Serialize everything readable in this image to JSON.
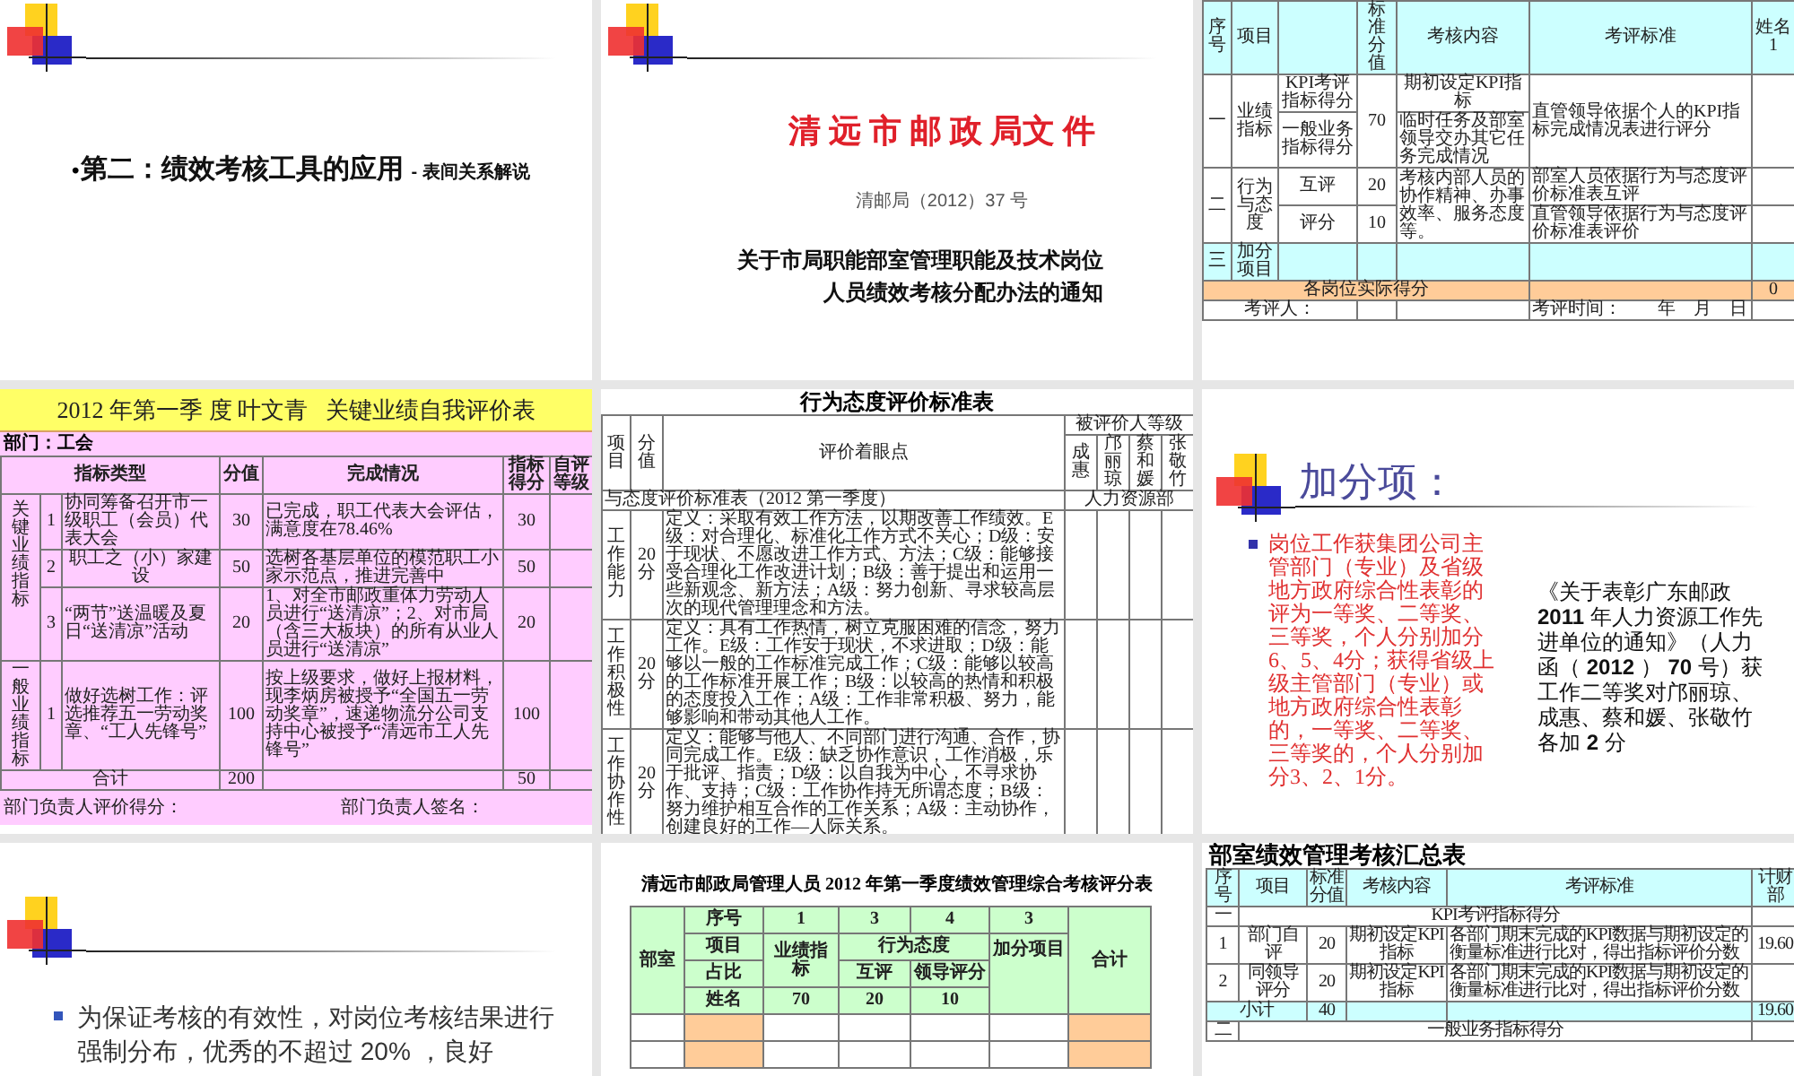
{
  "slides": [
    {
      "kind": "section_title",
      "bullet": "•",
      "title": "第二：绩效考核工具的应用",
      "subtitle": "- 表间关系解说"
    },
    {
      "kind": "document",
      "heading": "清 远 市 邮 政 局文 件",
      "doc_number": "清邮局（2012）37 号",
      "title_lines": [
        "关于市局职能部室管理职能及技术岗位",
        "人员绩效考核分配办法的通知"
      ]
    },
    {
      "kind": "kpi_table",
      "table": {
        "rows": [
          {
            "color": "#ccffff",
            "cells": [
              {
                "text": "序号"
              },
              {
                "text": "项目"
              },
              {},
              {
                "text": "标准分值"
              },
              {
                "text": "考核内容"
              },
              {
                "text": "考评标准"
              },
              {
                "text": "姓名1"
              }
            ]
          },
          {
            "color": "#ffffff",
            "cells": [
              {
                "text": "一",
                "rowspan": 2
              },
              {
                "text": "业绩指标",
                "rowspan": 2
              },
              {
                "text": "KPI考评指标得分"
              },
              {
                "text": "70",
                "rowspan": 2
              },
              {
                "text": "期初设定KPI指标"
              },
              {
                "text": "直管领导依据个人的KPI指标完成情况表进行评分",
                "rowspan": 2
              },
              {
                "rowspan": 2
              }
            ]
          },
          {
            "color": "#ffffff",
            "cells": [
              {
                "text": "一般业务指标得分"
              },
              {
                "text": "临时任务及部室领导交办其它任务完成情况"
              }
            ]
          },
          {
            "color": "#ffffff",
            "cells": [
              {
                "text": "二",
                "rowspan": 2
              },
              {
                "text": "行为与态度",
                "rowspan": 2
              },
              {
                "text": "互评"
              },
              {
                "text": "20"
              },
              {
                "text": "考核内部人员的协作精神、办事效率、服务态度等。",
                "rowspan": 2
              },
              {
                "text": "部室人员依据行为与态度评价标准表互评"
              },
              {}
            ]
          },
          {
            "color": "#ffffff",
            "cells": [
              {
                "text": "评分"
              },
              {
                "text": "10"
              },
              {
                "text": "直管领导依据行为与态度评价标准表评价"
              },
              {}
            ]
          },
          {
            "color": "#ccffff",
            "cells": [
              {
                "text": "三"
              },
              {
                "text": "加分项目"
              },
              {},
              {},
              {},
              {},
              {}
            ]
          },
          {
            "color": "#ffcc99",
            "cells": [
              {
                "text": "各岗位实际得分",
                "colspan": 5
              },
              {},
              {
                "text": "0"
              }
            ]
          },
          {
            "color": "#ffffff",
            "cells": [
              {
                "text": "考评人：",
                "colspan": 3
              },
              {},
              {},
              {
                "text": "考评时间：　　年　月　日"
              },
              {}
            ]
          }
        ]
      }
    },
    {
      "kind": "self_review",
      "title": "2012 年第一季 度 叶文青   关键业绩自我评价表",
      "department": "部门：工会",
      "table": {
        "rows": [
          {
            "kind": "header",
            "cells": [
              {
                "text": "指标类型",
                "colspan": 3
              },
              {
                "text": "分值"
              },
              {
                "text": "完成情况"
              },
              {
                "text": "指标得分"
              },
              {
                "text": "自评等级"
              }
            ]
          },
          {
            "kind": "body",
            "cells": [
              {
                "text": "关键业绩指标",
                "rowspan": 3
              },
              {
                "text": "1"
              },
              {
                "text": "协同筹备召开市一级职工（会员）代表大会"
              },
              {
                "text": "30"
              },
              {
                "text": "已完成，职工代表大会评估，满意度在78.46%"
              },
              {
                "text": "30"
              },
              {}
            ]
          },
          {
            "kind": "body",
            "cells": [
              {
                "text": "2"
              },
              {
                "text": "职工之（小）家建设"
              },
              {
                "text": "50"
              },
              {
                "text": "选树各基层单位的模范职工小家示范点，推进完善中"
              },
              {
                "text": "50"
              },
              {}
            ]
          },
          {
            "kind": "body",
            "cells": [
              {
                "text": "3"
              },
              {
                "text": "“两节”送温暖及夏日“送清凉”活动"
              },
              {
                "text": "20"
              },
              {
                "text": "1、对全市邮政重体力劳动人员进行“送清凉”；2、对市局（含三大板块）的所有从业人员进行“送清凉”"
              },
              {
                "text": "20"
              },
              {}
            ]
          },
          {
            "kind": "body",
            "cells": [
              {
                "text": "一般业绩指标"
              },
              {
                "text": "1"
              },
              {
                "text": "做好选树工作：评选推荐五一劳动奖章、“工人先锋号”"
              },
              {
                "text": "100"
              },
              {
                "text": "按上级要求，做好上报材料，现李炳房被授予“全国五一劳动奖章”，速递物流分公司支持中心被授予“清远市工人先锋号”"
              },
              {
                "text": "100"
              },
              {}
            ]
          },
          {
            "kind": "body",
            "cells": [
              {
                "text": "合计",
                "colspan": 3
              },
              {
                "text": "200"
              },
              {},
              {
                "text": "50"
              },
              {}
            ]
          }
        ]
      },
      "footer": [
        "部门负责人评价得分：",
        "部门负责人签名："
      ]
    },
    {
      "kind": "behavior_standard",
      "title": "行为态度评价标准表",
      "table": {
        "rows": [
          {
            "cells": [
              {
                "text": "项目",
                "rowspan": 2
              },
              {
                "text": "分值",
                "rowspan": 2
              },
              {
                "text": "评价着眼点",
                "rowspan": 2
              },
              {
                "text": "被评价人等级",
                "colspan": 4
              }
            ]
          },
          {
            "cells": [
              {
                "text": "成惠"
              },
              {
                "text": "邝丽琼"
              },
              {
                "text": "蔡和媛"
              },
              {
                "text": "张敬竹"
              }
            ]
          },
          {
            "cells": [
              {
                "text": "与态度评价标准表（2012 第一季度）",
                "colspan": 3
              },
              {
                "text": "人力资源部",
                "colspan": 4
              }
            ]
          },
          {
            "cells": [
              {
                "text": "工作能力"
              },
              {
                "text": "20分"
              },
              {
                "text": "定义：采取有效工作方法，以期改善工作绩效。E级：对合理化、标准化工作方式不关心；D级：安于现状、不愿改进工作方式、方法；C级：能够接受合理化工作改进计划；B级：善于提出和运用一些新观念、新方法；A级：努力创新、寻求较高层次的现代管理理念和方法。"
              },
              {},
              {},
              {},
              {}
            ]
          },
          {
            "cells": [
              {
                "text": "工作积极性"
              },
              {
                "text": "20分"
              },
              {
                "text": "定义：具有工作热情，树立克服困难的信念，努力工作。E级：工作安于现状，不求进取；D级：能够以一般的工作标准完成工作；C级：能够以较高的工作标准开展工作；B级：以较高的热情和积极的态度投入工作；A级：工作非常积极、努力，能够影响和带动其他人工作。"
              },
              {},
              {},
              {},
              {}
            ]
          },
          {
            "cells": [
              {
                "text": "工作协作性"
              },
              {
                "text": "20分"
              },
              {
                "text": "定义：能够与他人、不同部门进行沟通、合作，协同完成工作。E级：缺乏协作意识，工作消极，乐于批评、指责；D级：以自我为中心，不寻求协作、支持；C级：工作协作持无所谓态度；B级：努力维护相互合作的工作关系；A级：主动协作，创建良好的工作—人际关系。"
              },
              {},
              {},
              {},
              {}
            ]
          }
        ]
      }
    },
    {
      "kind": "bonus",
      "title": "加分项：",
      "bullet_text": "岗位工作获集团公司主管部门（专业）及省级地方政府综合性表彰的评为一等奖、二等奖、三等奖，个人分别加分6、5、4分；获得省级上级主管部门（专业）或地方政府综合性表彰的，一等奖、二等奖、三等奖的，个人分别加分3、2、1分。",
      "note": "《关于表彰广东邮政 **2011** 年人力资源工作先进单位的通知》（人力函（ **2012** ） **70** 号）获工作二等奖对邝丽琼、成惠、蔡和媛、张敬竹各加 **2** 分"
    },
    {
      "kind": "bullet",
      "text": "为保证考核的有效性，对岗位考核结果进行强制分布，优秀的不超过 20% ，良好"
    },
    {
      "kind": "score_sheet",
      "title": "清远市邮政局管理人员 2012 年第一季度绩效管理综合考核评分表",
      "table": {
        "rows": [
          {
            "kind": "header",
            "cells": [
              {
                "text": "部室",
                "rowspan": 4
              },
              {
                "text": "序号"
              },
              {
                "text": "1"
              },
              {
                "text": "3"
              },
              {
                "text": "4"
              },
              {
                "text": "3"
              },
              {
                "text": "合计",
                "rowspan": 4
              }
            ]
          },
          {
            "kind": "header",
            "cells": [
              {
                "text": "项目"
              },
              {
                "text": "业绩指标",
                "rowspan": 2
              },
              {
                "text": "行为态度",
                "colspan": 2
              },
              {
                "text": "加分项目",
                "rowspan": 3
              }
            ]
          },
          {
            "kind": "header",
            "cells": [
              {
                "text": "占比"
              },
              {
                "text": "互评"
              },
              {
                "text": "领导评分"
              }
            ]
          },
          {
            "kind": "header",
            "cells": [
              {
                "text": "姓名"
              },
              {
                "text": "70"
              },
              {
                "text": "20"
              },
              {
                "text": "10"
              }
            ]
          },
          {
            "kind": "body",
            "cells": [
              {},
              {
                "color": "#ffcc99"
              },
              {},
              {},
              {},
              {},
              {
                "color": "#ffcc99"
              }
            ]
          },
          {
            "kind": "body",
            "cells": [
              {},
              {
                "color": "#ffcc99"
              },
              {},
              {},
              {},
              {},
              {
                "color": "#ffcc99"
              }
            ]
          }
        ]
      }
    },
    {
      "kind": "summary_table",
      "title": "部室绩效管理考核汇总表",
      "table": {
        "rows": [
          {
            "color": "#ccffff",
            "cells": [
              {
                "text": "序号"
              },
              {
                "text": "项目"
              },
              {
                "text": "标准分值"
              },
              {
                "text": "考核内容"
              },
              {
                "text": "考评标准"
              },
              {
                "text": "计财部"
              }
            ]
          },
          {
            "color": "#ffffff",
            "cells": [
              {
                "text": "一"
              },
              {
                "text": "KPI考评指标得分",
                "colspan": 4
              },
              {}
            ]
          },
          {
            "color": "#ffffff",
            "cells": [
              {
                "text": "1"
              },
              {
                "text": "部门自评"
              },
              {
                "text": "20"
              },
              {
                "text": "期初设定KPI指标"
              },
              {
                "text": "各部门期末完成的KPI数据与期初设定的衡量标准进行比对，得出指标评价分数"
              },
              {
                "text": "19.60"
              }
            ]
          },
          {
            "color": "#ffffff",
            "cells": [
              {
                "text": "2"
              },
              {
                "text": "同领导评分"
              },
              {
                "text": "20"
              },
              {
                "text": "期初设定KPI指标"
              },
              {
                "text": "各部门期末完成的KPI数据与期初设定的衡量标准进行比对，得出指标评价分数"
              },
              {}
            ]
          },
          {
            "color": "#ccffff",
            "cells": [
              {
                "text": "小计",
                "colspan": 2
              },
              {
                "text": "40"
              },
              {},
              {},
              {
                "text": "19.60"
              }
            ]
          },
          {
            "color": "#ffffff",
            "cells": [
              {
                "text": "二"
              },
              {
                "text": "一般业务指标得分",
                "colspan": 4
              },
              {}
            ]
          }
        ]
      }
    }
  ]
}
